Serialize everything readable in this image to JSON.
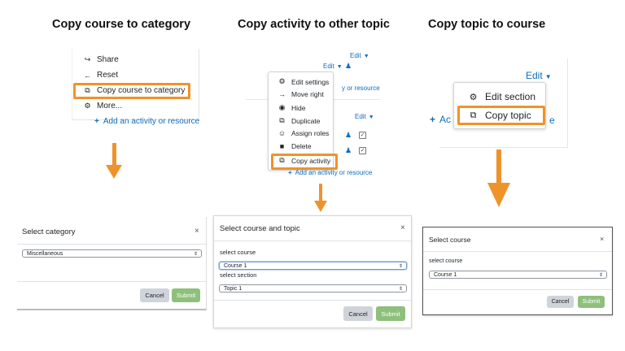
{
  "headings": {
    "left": "Copy course to category",
    "middle": "Copy activity to other topic",
    "right": "Copy topic to course"
  },
  "left_menu": {
    "items": [
      {
        "icon": "share-icon",
        "glyph": "↪",
        "label": "Share"
      },
      {
        "icon": "reset-icon",
        "glyph": "←",
        "label": "Reset"
      },
      {
        "icon": "copy-icon",
        "glyph": "⧉",
        "label": "Copy course to category"
      },
      {
        "icon": "gear-icon",
        "glyph": "⚙",
        "label": "More..."
      }
    ],
    "add_activity": "Add an activity or resource"
  },
  "middle_menu": {
    "edit_label": "Edit",
    "items": [
      {
        "icon": "gear-icon",
        "glyph": "⚙",
        "label": "Edit settings"
      },
      {
        "icon": "arrow-right-icon",
        "glyph": "→",
        "label": "Move right"
      },
      {
        "icon": "eye-icon",
        "glyph": "◉",
        "label": "Hide"
      },
      {
        "icon": "copy-icon",
        "glyph": "⧉",
        "label": "Duplicate"
      },
      {
        "icon": "user-icon",
        "glyph": "☺",
        "label": "Assign roles"
      },
      {
        "icon": "trash-icon",
        "glyph": "■",
        "label": "Delete"
      },
      {
        "icon": "copy-icon",
        "glyph": "⧉",
        "label": "Copy activity"
      }
    ],
    "partial_link": "y or resource",
    "add_activity": "Add an activity or resource"
  },
  "right_menu": {
    "edit_label": "Edit",
    "items": [
      {
        "icon": "gear-icon",
        "glyph": "⚙",
        "label": "Edit section"
      },
      {
        "icon": "copy-icon",
        "glyph": "⧉",
        "label": "Copy topic"
      }
    ],
    "partial_add": "Ac",
    "partial_e": "e"
  },
  "dialog_left": {
    "title": "Select category",
    "close": "×",
    "selected": "Miscellaneous",
    "cancel": "Cancel",
    "submit": "Submit"
  },
  "dialog_middle": {
    "title": "Select course and topic",
    "close": "×",
    "course_label": "select course",
    "course_value": "Course 1",
    "section_label": "select section",
    "section_value": "Topic 1",
    "cancel": "Cancel",
    "submit": "Submit"
  },
  "dialog_right": {
    "title": "Select course",
    "close": "×",
    "course_label": "select course",
    "course_value": "Course 1",
    "cancel": "Cancel",
    "submit": "Submit"
  },
  "colors": {
    "highlight": "#f0922b",
    "link": "#0f6cbf",
    "submit": "#8ec07b",
    "cancel": "#ced4da"
  }
}
